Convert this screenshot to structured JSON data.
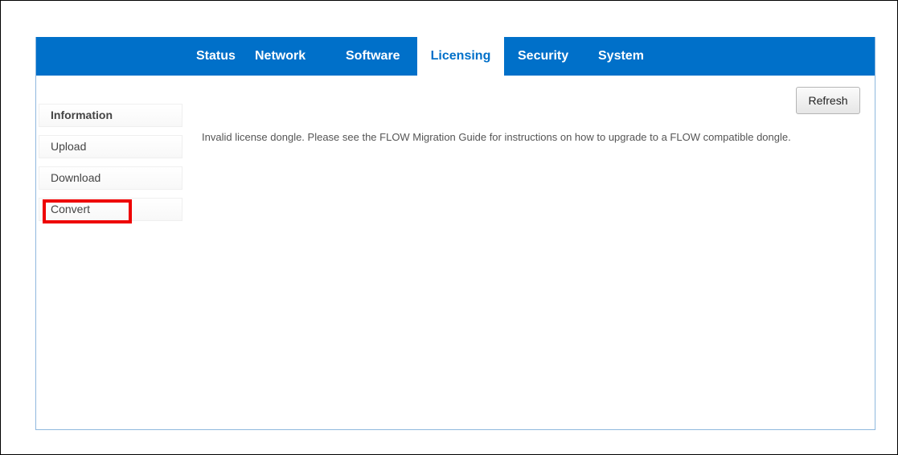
{
  "nav": {
    "tabs": [
      {
        "label": "Status"
      },
      {
        "label": "Network"
      },
      {
        "label": "Software"
      },
      {
        "label": "Licensing",
        "active": true
      },
      {
        "label": "Security"
      },
      {
        "label": "System"
      }
    ]
  },
  "sidebar": {
    "items": [
      {
        "label": "Information",
        "bold": true
      },
      {
        "label": "Upload"
      },
      {
        "label": "Download"
      },
      {
        "label": "Convert",
        "highlighted": true
      }
    ]
  },
  "content": {
    "refresh_label": "Refresh",
    "message": "Invalid license dongle. Please see the FLOW Migration Guide for instructions on how to upgrade to a FLOW compatible dongle."
  },
  "colors": {
    "navbar": "#0070c9",
    "highlight": "#ee0000"
  }
}
